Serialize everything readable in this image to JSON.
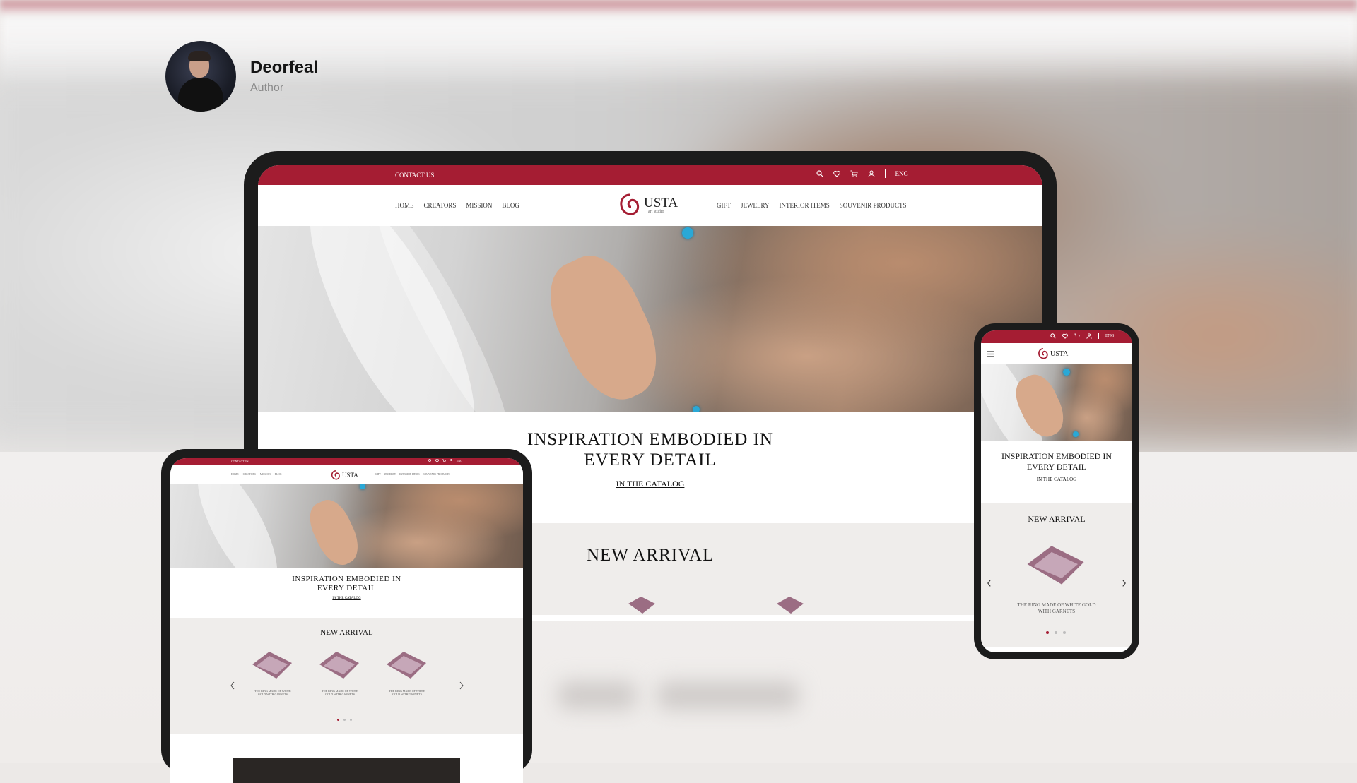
{
  "author": {
    "name": "Deorfeal",
    "role": "Author"
  },
  "site": {
    "contact": "CONTACT US",
    "lang": "ENG",
    "nav_left": [
      "HOME",
      "CREATORS",
      "MISSION",
      "BLOG"
    ],
    "nav_right": [
      "GIFT",
      "JEWELRY",
      "INTERIOR ITEMS",
      "SOUVENIR PRODUCTS"
    ],
    "logo_name": "USTA",
    "logo_sub": "art studio",
    "hero_title_line1": "INSPIRATION EMBODIED IN",
    "hero_title_line2": "EVERY DETAIL",
    "catalog_link": "IN THE CATALOG",
    "new_arrival": "NEW ARRIVAL",
    "product_line1": "THE RING MADE OF WHITE",
    "product_line2": "GOLD WITH GARNETS",
    "phone_product_line1": "THE RING MADE OF WHITE GOLD",
    "phone_product_line2": "WITH GARNETS"
  },
  "colors": {
    "brand": "#a51d33",
    "section_gray": "#efedeb",
    "device_frame": "#1c1c1c"
  },
  "icons": [
    "search-icon",
    "heart-icon",
    "cart-icon",
    "user-icon",
    "menu-icon",
    "chevron-left-icon",
    "chevron-right-icon"
  ]
}
